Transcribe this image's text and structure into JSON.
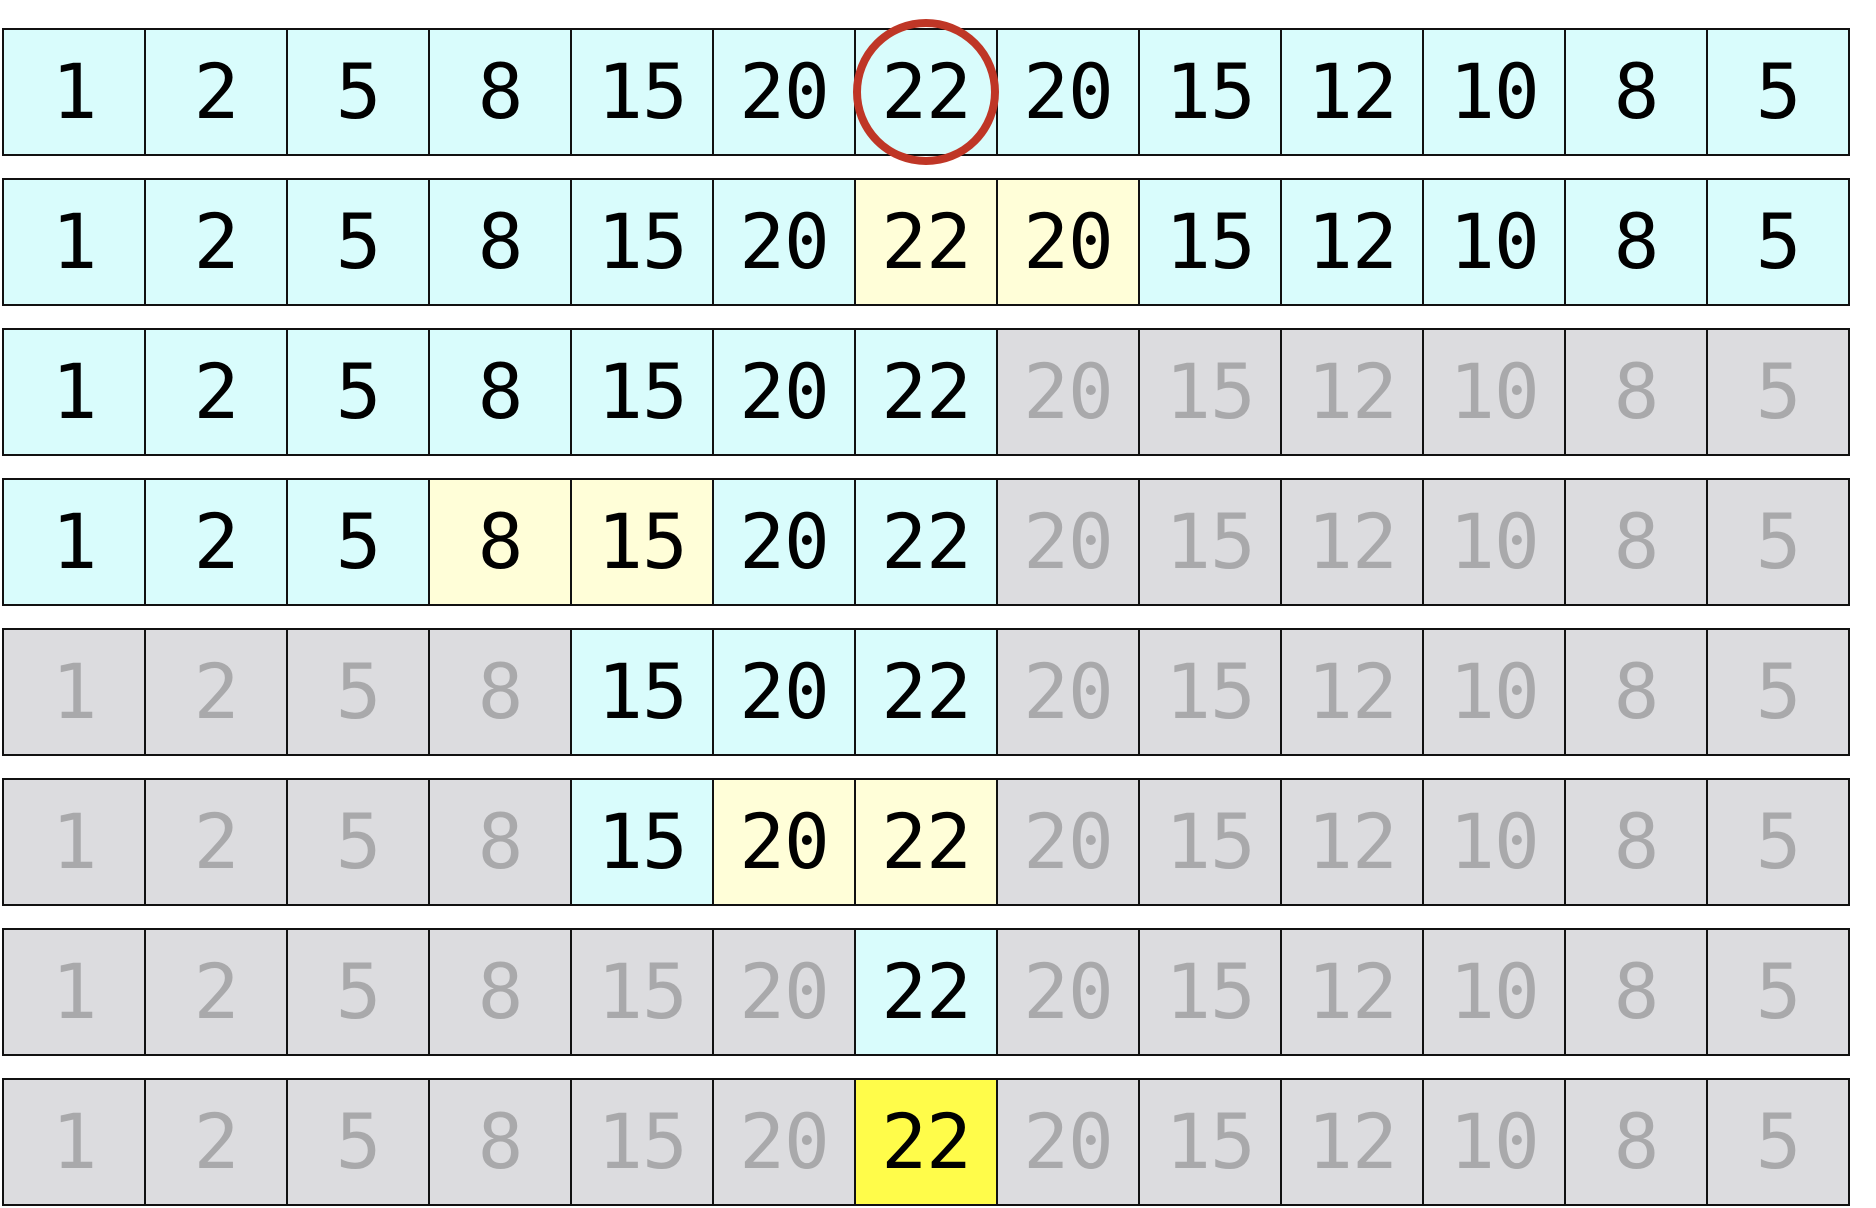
{
  "array": [
    "1",
    "2",
    "5",
    "8",
    "15",
    "20",
    "22",
    "20",
    "15",
    "12",
    "10",
    "8",
    "5"
  ],
  "steps": [
    {
      "states": [
        "active",
        "active",
        "active",
        "active",
        "active",
        "active",
        "active",
        "active",
        "active",
        "active",
        "active",
        "active",
        "active"
      ],
      "circled_index": 6
    },
    {
      "states": [
        "active",
        "active",
        "active",
        "active",
        "active",
        "active",
        "compare",
        "compare",
        "active",
        "active",
        "active",
        "active",
        "active"
      ]
    },
    {
      "states": [
        "active",
        "active",
        "active",
        "active",
        "active",
        "active",
        "active",
        "eliminated",
        "eliminated",
        "eliminated",
        "eliminated",
        "eliminated",
        "eliminated"
      ]
    },
    {
      "states": [
        "active",
        "active",
        "active",
        "compare",
        "compare",
        "active",
        "active",
        "eliminated",
        "eliminated",
        "eliminated",
        "eliminated",
        "eliminated",
        "eliminated"
      ]
    },
    {
      "states": [
        "eliminated",
        "eliminated",
        "eliminated",
        "eliminated",
        "active",
        "active",
        "active",
        "eliminated",
        "eliminated",
        "eliminated",
        "eliminated",
        "eliminated",
        "eliminated"
      ]
    },
    {
      "states": [
        "eliminated",
        "eliminated",
        "eliminated",
        "eliminated",
        "active",
        "compare",
        "compare",
        "eliminated",
        "eliminated",
        "eliminated",
        "eliminated",
        "eliminated",
        "eliminated"
      ]
    },
    {
      "states": [
        "eliminated",
        "eliminated",
        "eliminated",
        "eliminated",
        "eliminated",
        "eliminated",
        "active",
        "eliminated",
        "eliminated",
        "eliminated",
        "eliminated",
        "eliminated",
        "eliminated"
      ]
    },
    {
      "states": [
        "eliminated",
        "eliminated",
        "eliminated",
        "eliminated",
        "eliminated",
        "eliminated",
        "found",
        "eliminated",
        "eliminated",
        "eliminated",
        "eliminated",
        "eliminated",
        "eliminated"
      ]
    }
  ],
  "colors": {
    "active": "#d9fcfc",
    "compare": "#fffed8",
    "eliminated": "#dcdcdf",
    "found": "#fffc4a",
    "marker": "#bf3626"
  }
}
